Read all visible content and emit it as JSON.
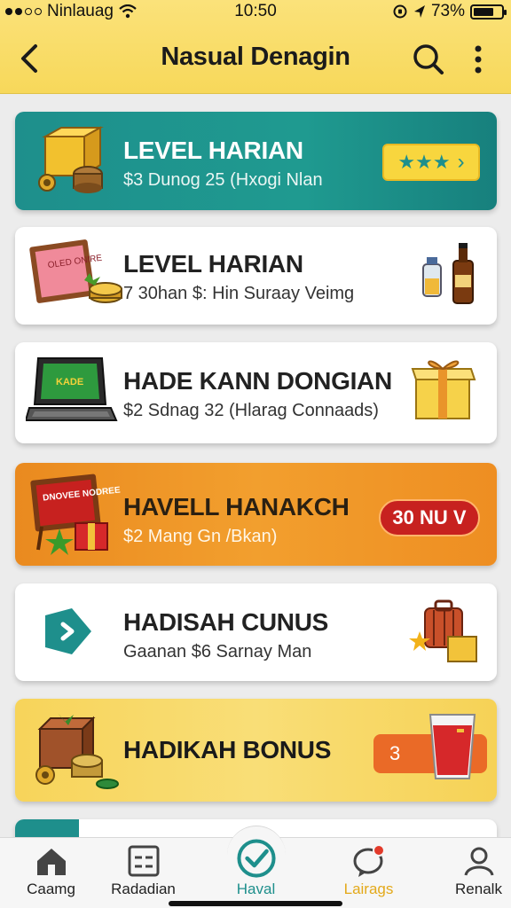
{
  "status_bar": {
    "carrier": "Ninlauag",
    "time": "10:50",
    "battery": "73%",
    "battery_level": 0.73
  },
  "header": {
    "title": "Nasual Denagin",
    "back_icon": "chevron-left-icon",
    "search_icon": "search-icon",
    "more_icon": "more-vertical-icon"
  },
  "cards": [
    {
      "title": "LEVEL HARIAN",
      "subtitle": "$3 Dunog 25 (Hxogi Nlan",
      "badge": "★★★",
      "badge_chevron": "›",
      "color": "#1e8f8c"
    },
    {
      "title": "LEVEL HARIAN",
      "subtitle": "7 30han $: Hin Suraay Veimg",
      "sign_text": "OLED ONIRE"
    },
    {
      "title": "HADE KANN DONGIAN",
      "subtitle": "$2 Sdnag 32 (Hlarag Connaads)",
      "screen_text": "KADE"
    },
    {
      "title": "HAVELL HANAKCH",
      "subtitle": "$2 Mang Gn /Bkan)",
      "badge": "30 NU V",
      "sign_text": "DNOVEE NODREE",
      "color": "#f29f2e"
    },
    {
      "title": "HADISAH CUNUS",
      "subtitle": "Gaanan $6 Sarnay Man"
    },
    {
      "title": "HADIKAH BONUS",
      "badge": "3",
      "color": "#f7d45a"
    }
  ],
  "bottom_nav": [
    {
      "label": "Caamg",
      "icon": "home-icon"
    },
    {
      "label": "Radadian",
      "icon": "grid-icon"
    },
    {
      "label": "Haval",
      "icon": "check-circle-icon",
      "active": true
    },
    {
      "label": "Lairags",
      "icon": "chat-bubble-icon"
    },
    {
      "label": "Renalk",
      "icon": "user-icon"
    }
  ]
}
